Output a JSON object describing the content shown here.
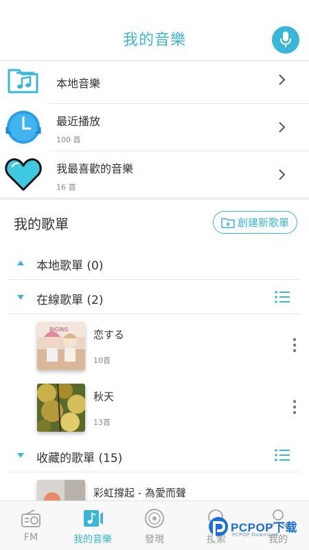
{
  "header": {
    "title": "我的音樂",
    "mic_icon": "microphone-icon"
  },
  "menu": [
    {
      "label": "本地音樂",
      "sub": "",
      "icon": "music-folder-icon"
    },
    {
      "label": "最近播放",
      "sub": "100 首",
      "icon": "clock-icon"
    },
    {
      "label": "我最喜歡的音樂",
      "sub": "16 首",
      "icon": "heart-icon"
    }
  ],
  "playlists": {
    "title": "我的歌單",
    "create_label": "創建新歌單",
    "groups": [
      {
        "label": "本地歌單 (0)",
        "expanded": false
      },
      {
        "label": "在線歌單 (2)",
        "expanded": true
      },
      {
        "label": "收藏的歌單 (15)",
        "expanded": true
      }
    ],
    "songs": [
      {
        "name": "恋する",
        "count": "10首"
      },
      {
        "name": "秋天",
        "count": "13首"
      },
      {
        "name": "彩虹撐起 - 為愛而聲",
        "count": ""
      }
    ]
  },
  "nav": {
    "items": [
      {
        "label": "FM",
        "icon": "radio-icon"
      },
      {
        "label": "我的音樂",
        "icon": "music-note-icon"
      },
      {
        "label": "發現",
        "icon": "disc-icon"
      },
      {
        "label": "搜索",
        "icon": "search-icon"
      },
      {
        "label": "我的",
        "icon": "user-icon"
      }
    ],
    "active_index": 1
  },
  "watermark": {
    "text": "PCPOP下载",
    "sub": "PCPOP Download"
  },
  "colors": {
    "accent": "#3bb6d6",
    "heart": "#3ec9e0",
    "text": "#333333",
    "muted": "#888888"
  }
}
